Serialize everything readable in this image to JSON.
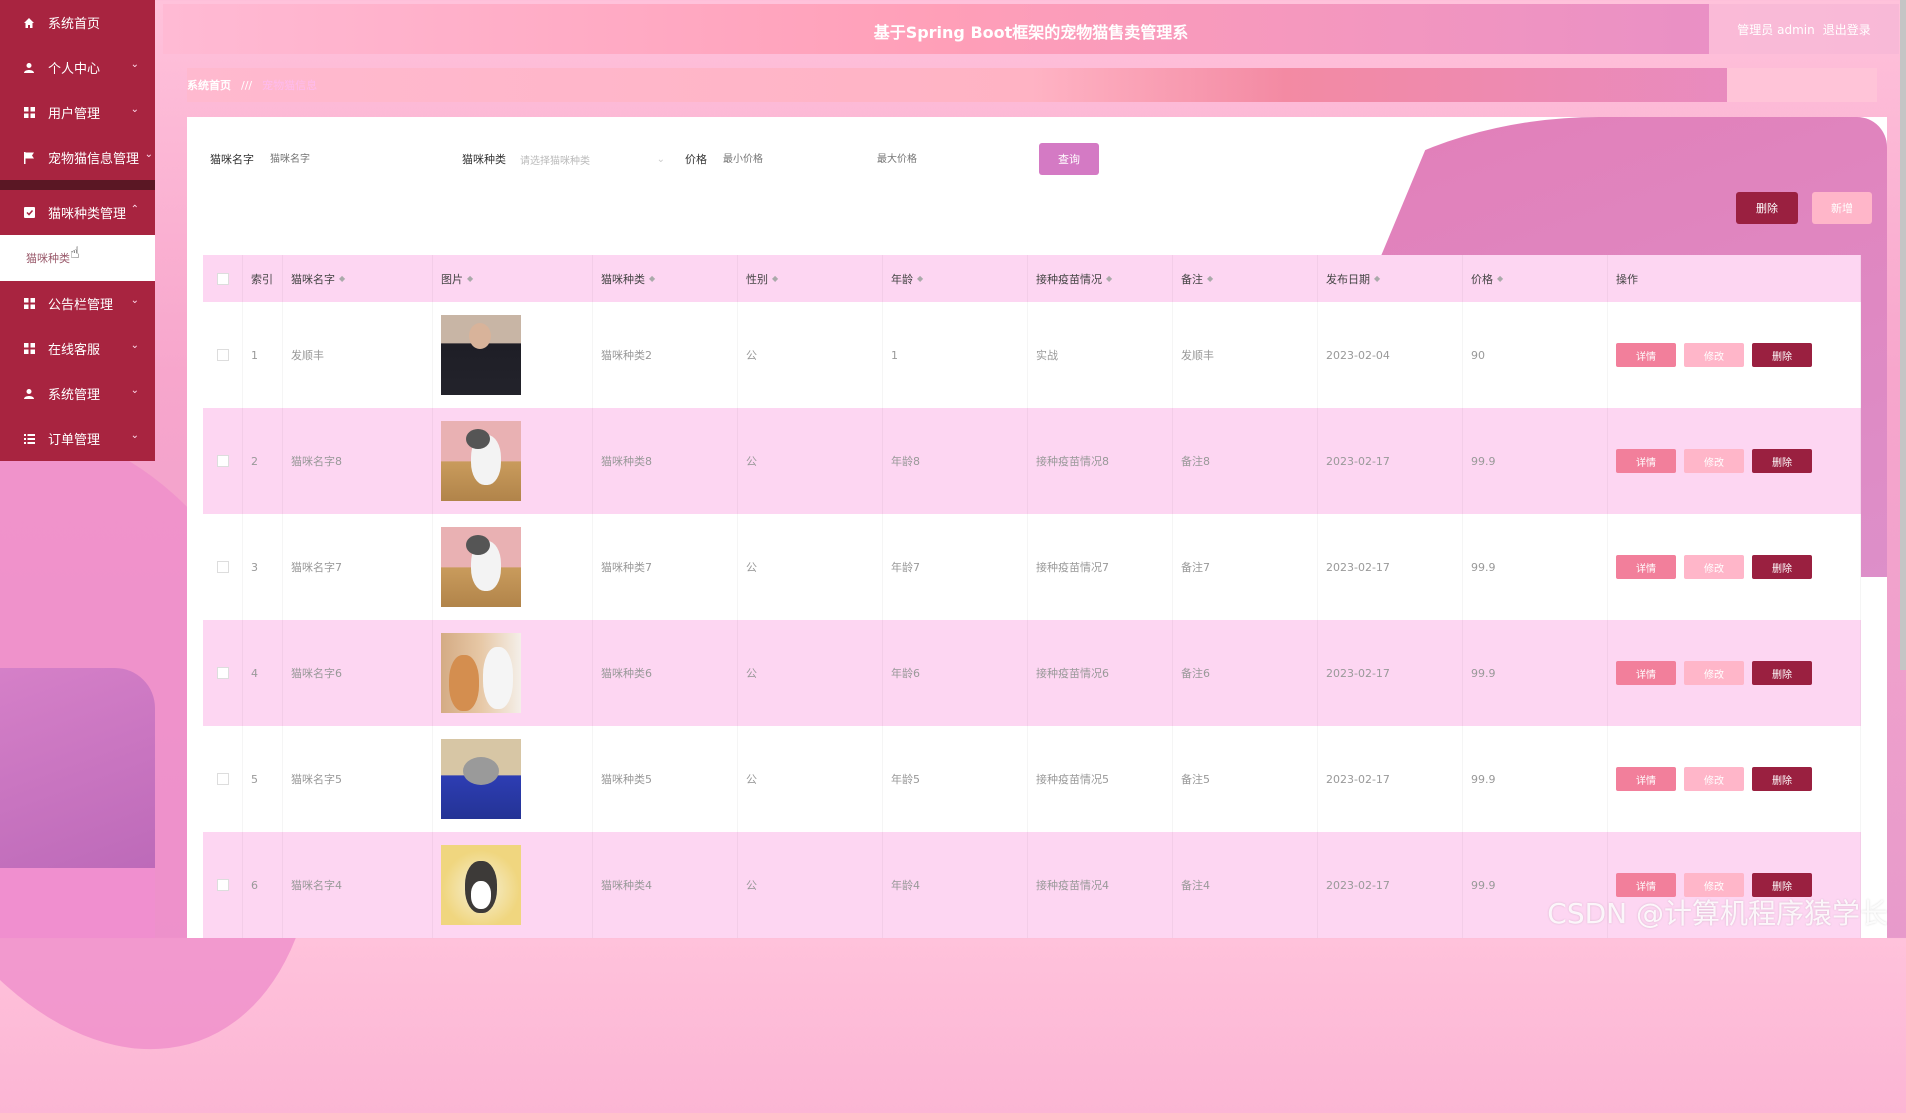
{
  "app": {
    "title": "基于Spring Boot框架的宠物猫售卖管理系",
    "user": "管理员 admin",
    "logout": "退出登录"
  },
  "breadcrumb": {
    "home": "系统首页",
    "sep": "///",
    "current": "宠物猫信息"
  },
  "sidebar": {
    "items": [
      {
        "label": "系统首页",
        "icon": "home-icon"
      },
      {
        "label": "个人中心",
        "icon": "user-icon"
      },
      {
        "label": "用户管理",
        "icon": "grid-icon"
      },
      {
        "label": "宠物猫信息管理",
        "icon": "flag-icon"
      },
      {
        "label": "猫咪种类管理",
        "icon": "tag-icon",
        "expanded": true
      },
      {
        "label": "公告栏管理",
        "icon": "grid-icon"
      },
      {
        "label": "在线客服",
        "icon": "grid-icon"
      },
      {
        "label": "系统管理",
        "icon": "user-icon"
      },
      {
        "label": "订单管理",
        "icon": "list-icon"
      }
    ],
    "submenu": "猫咪种类"
  },
  "search": {
    "name_label": "猫咪名字",
    "name_placeholder": "猫咪名字",
    "type_label": "猫咪种类",
    "type_placeholder": "请选择猫咪种类",
    "price_label": "价格",
    "min_placeholder": "最小价格",
    "max_placeholder": "最大价格",
    "query": "查询"
  },
  "actions": {
    "delete": "删除",
    "add": "新增"
  },
  "table": {
    "headers": [
      "索引",
      "猫咪名字",
      "图片",
      "猫咪种类",
      "性别",
      "年龄",
      "接种疫苗情况",
      "备注",
      "发布日期",
      "价格",
      "操作"
    ],
    "row_actions": {
      "detail": "详情",
      "edit": "修改",
      "delete": "删除"
    },
    "rows": [
      {
        "idx": "1",
        "name": "发顺丰",
        "type": "猫咪种类2",
        "sex": "公",
        "age": "1",
        "vac": "实战",
        "note": "发顺丰",
        "date": "2023-02-04",
        "price": "90"
      },
      {
        "idx": "2",
        "name": "猫咪名字8",
        "type": "猫咪种类8",
        "sex": "公",
        "age": "年龄8",
        "vac": "接种疫苗情况8",
        "note": "备注8",
        "date": "2023-02-17",
        "price": "99.9"
      },
      {
        "idx": "3",
        "name": "猫咪名字7",
        "type": "猫咪种类7",
        "sex": "公",
        "age": "年龄7",
        "vac": "接种疫苗情况7",
        "note": "备注7",
        "date": "2023-02-17",
        "price": "99.9"
      },
      {
        "idx": "4",
        "name": "猫咪名字6",
        "type": "猫咪种类6",
        "sex": "公",
        "age": "年龄6",
        "vac": "接种疫苗情况6",
        "note": "备注6",
        "date": "2023-02-17",
        "price": "99.9"
      },
      {
        "idx": "5",
        "name": "猫咪名字5",
        "type": "猫咪种类5",
        "sex": "公",
        "age": "年龄5",
        "vac": "接种疫苗情况5",
        "note": "备注5",
        "date": "2023-02-17",
        "price": "99.9"
      },
      {
        "idx": "6",
        "name": "猫咪名字4",
        "type": "猫咪种类4",
        "sex": "公",
        "age": "年龄4",
        "vac": "接种疫苗情况4",
        "note": "备注4",
        "date": "2023-02-17",
        "price": "99.9"
      }
    ]
  },
  "watermark": "CSDN @计算机程序猿学长",
  "colors": {
    "primary": "#a82440",
    "accent": "#d47ac4",
    "row_alt": "#fdd6f2",
    "delete": "#9a2040",
    "detail": "#f27f9b",
    "edit": "#ffb6c9"
  }
}
